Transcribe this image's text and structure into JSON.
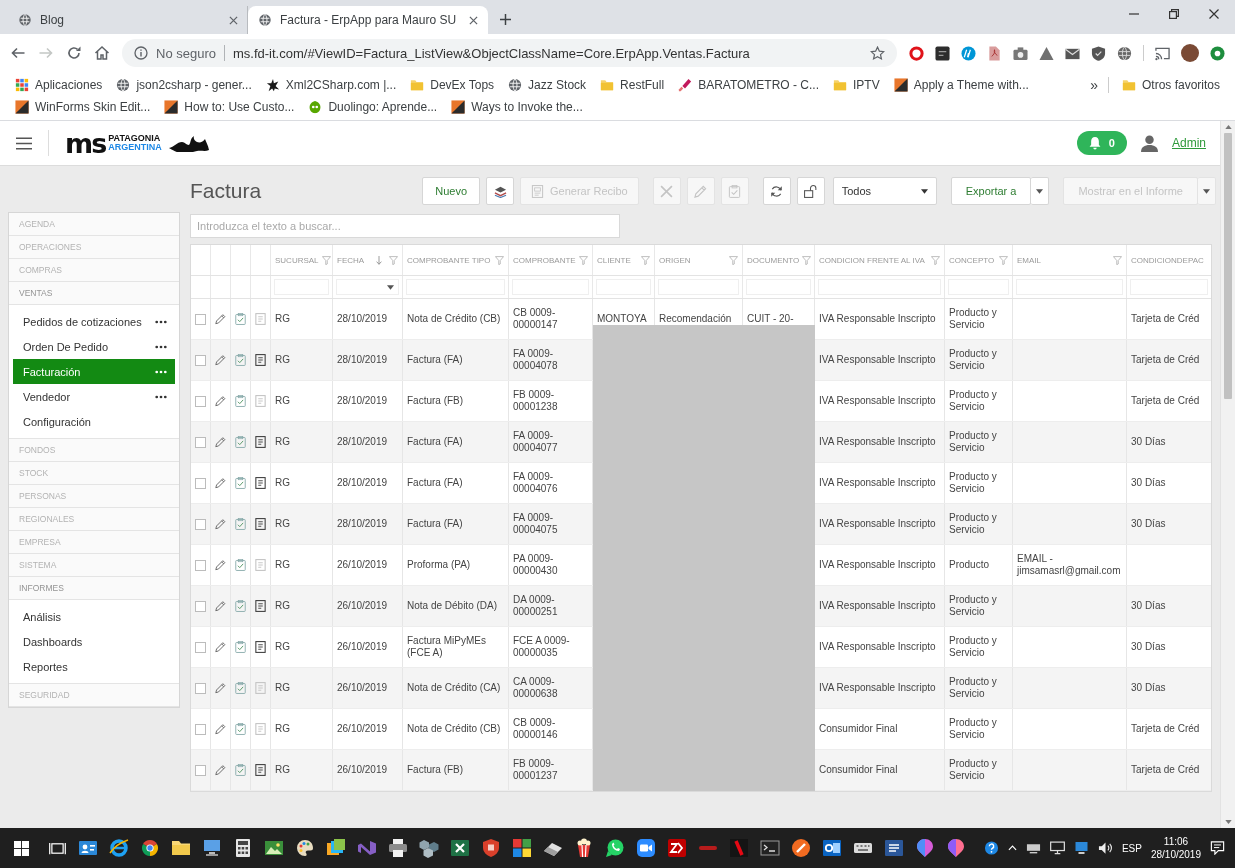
{
  "browser": {
    "tabs": [
      {
        "title": "Blog",
        "selected": false
      },
      {
        "title": "Factura - ErpApp para Mauro SU",
        "selected": true
      }
    ],
    "nav": [
      {
        "kind": "back",
        "disabled": false
      },
      {
        "kind": "forward",
        "disabled": true
      },
      {
        "kind": "reload",
        "disabled": false
      },
      {
        "kind": "home",
        "disabled": false
      }
    ],
    "address": {
      "security": "No seguro",
      "url": "ms.fd-it.com/#ViewID=Factura_ListView&ObjectClassName=Core.ErpApp.Ventas.Factura"
    },
    "bookmarks": [
      {
        "kind": "apps",
        "label": "Aplicaciones"
      },
      {
        "kind": "globe",
        "label": "json2csharp - gener..."
      },
      {
        "kind": "splat",
        "label": "Xml2CSharp.com |..."
      },
      {
        "kind": "folder",
        "label": "DevEx Tops"
      },
      {
        "kind": "globe",
        "label": "Jazz Stock"
      },
      {
        "kind": "folder",
        "label": "RestFull"
      },
      {
        "kind": "brush",
        "label": "BARATOMETRO - C..."
      },
      {
        "kind": "folder",
        "label": "IPTV"
      },
      {
        "kind": "tile",
        "label": "Apply a Theme with..."
      },
      {
        "kind": "tile",
        "label": "WinForms Skin Edit..."
      },
      {
        "kind": "tile",
        "label": "How to: Use Custo..."
      },
      {
        "kind": "leaf",
        "label": "Duolingo: Aprende..."
      },
      {
        "kind": "tile",
        "label": "Ways to Invoke the..."
      }
    ],
    "more_bookmarks": "»",
    "other_bookmarks": "Otros favoritos"
  },
  "app": {
    "logo": {
      "mark": "ms",
      "line1": "PATAGONIA",
      "line2": "ARGENTINA"
    },
    "notifications": {
      "count": "0"
    },
    "user": {
      "name": "Admin"
    },
    "sidebar": {
      "groups": [
        {
          "label": "AGENDA",
          "expanded": false
        },
        {
          "label": "OPERACIONES",
          "expanded": false
        },
        {
          "label": "COMPRAS",
          "expanded": false
        },
        {
          "label": "VENTAS",
          "expanded": true,
          "items": [
            {
              "label": "Pedidos de cotizaciones",
              "has_menu": true,
              "selected": false
            },
            {
              "label": "Orden De Pedido",
              "has_menu": true,
              "selected": false
            },
            {
              "label": "Facturación",
              "has_menu": true,
              "selected": true
            },
            {
              "label": "Vendedor",
              "has_menu": true,
              "selected": false
            },
            {
              "label": "Configuración",
              "has_menu": false,
              "selected": false
            }
          ]
        },
        {
          "label": "FONDOS",
          "expanded": false
        },
        {
          "label": "STOCK",
          "expanded": false
        },
        {
          "label": "PERSONAS",
          "expanded": false
        },
        {
          "label": "REGIONALES",
          "expanded": false
        },
        {
          "label": "EMPRESA",
          "expanded": false
        },
        {
          "label": "SISTEMA",
          "expanded": false
        },
        {
          "label": "INFORMES",
          "expanded": true,
          "items": [
            {
              "label": "Análisis",
              "has_menu": false,
              "selected": false
            },
            {
              "label": "Dashboards",
              "has_menu": false,
              "selected": false
            },
            {
              "label": "Reportes",
              "has_menu": false,
              "selected": false
            }
          ]
        },
        {
          "label": "SEGURIDAD",
          "expanded": false
        }
      ]
    },
    "title": "Factura",
    "toolbar": [
      {
        "kind": "new",
        "label": "Nuevo",
        "disabled": false
      },
      {
        "kind": "tool",
        "disabled": false
      },
      {
        "kind": "receipt",
        "label": "Generar Recibo",
        "disabled": true
      },
      {
        "kind": "delete",
        "disabled": true
      },
      {
        "kind": "edit",
        "disabled": true
      },
      {
        "kind": "approve",
        "disabled": true
      },
      {
        "kind": "refresh",
        "disabled": false
      },
      {
        "kind": "unlock",
        "disabled": false
      },
      {
        "kind": "select",
        "value": "Todos",
        "disabled": false
      },
      {
        "kind": "split",
        "label": "Exportar a",
        "disabled": false
      },
      {
        "kind": "split",
        "label": "Mostrar en el Informe",
        "disabled": true
      }
    ],
    "search": {
      "placeholder": "Introduzca el texto a buscar..."
    },
    "table": {
      "columns": [
        {
          "kind": "text",
          "label": "SUCURSAL",
          "sort_desc": false,
          "filter": true
        },
        {
          "kind": "date",
          "label": "FECHA",
          "sort_desc": true,
          "filter": true
        },
        {
          "kind": "text",
          "label": "COMPROBANTE TIPO",
          "sort_desc": false,
          "filter": true
        },
        {
          "kind": "text",
          "label": "COMPROBANTE",
          "sort_desc": false,
          "filter": true
        },
        {
          "kind": "text",
          "label": "CLIENTE",
          "sort_desc": false,
          "filter": true
        },
        {
          "kind": "text",
          "label": "ORIGEN",
          "sort_desc": false,
          "filter": true
        },
        {
          "kind": "text",
          "label": "DOCUMENTO",
          "sort_desc": false,
          "filter": true
        },
        {
          "kind": "text",
          "label": "CONDICION FRENTE AL IVA",
          "sort_desc": false,
          "filter": true
        },
        {
          "kind": "text",
          "label": "CONCEPTO",
          "sort_desc": false,
          "filter": true
        },
        {
          "kind": "text",
          "label": "EMAIL",
          "sort_desc": false,
          "filter": true
        },
        {
          "kind": "text",
          "label": "CONDICIONDEPAC",
          "sort_desc": false,
          "filter": false
        }
      ],
      "rows": [
        {
          "selected": false,
          "doc_enabled": false,
          "cells": [
            "RG",
            "28/10/2019",
            "Nota de Crédito (CB)",
            "CB 0009-00000147",
            "MONTOYA",
            "Recomendación",
            "CUIT - 20-",
            "IVA Responsable Inscripto",
            "Producto y Servicio",
            null,
            "Tarjeta de Créd"
          ]
        },
        {
          "selected": false,
          "doc_enabled": true,
          "cells": [
            "RG",
            "28/10/2019",
            "Factura (FA)",
            "FA 0009-00004078",
            null,
            null,
            null,
            "IVA Responsable Inscripto",
            "Producto y Servicio",
            null,
            "Tarjeta de Créd"
          ]
        },
        {
          "selected": false,
          "doc_enabled": false,
          "cells": [
            "RG",
            "28/10/2019",
            "Factura (FB)",
            "FB 0009-00001238",
            null,
            null,
            null,
            "IVA Responsable Inscripto",
            "Producto y Servicio",
            null,
            "Tarjeta de Créd"
          ]
        },
        {
          "selected": false,
          "doc_enabled": true,
          "cells": [
            "RG",
            "28/10/2019",
            "Factura (FA)",
            "FA 0009-00004077",
            null,
            null,
            null,
            "IVA Responsable Inscripto",
            "Producto y Servicio",
            null,
            "30 Días"
          ]
        },
        {
          "selected": false,
          "doc_enabled": true,
          "cells": [
            "RG",
            "28/10/2019",
            "Factura (FA)",
            "FA 0009-00004076",
            null,
            null,
            null,
            "IVA Responsable Inscripto",
            "Producto y Servicio",
            null,
            "30 Días"
          ]
        },
        {
          "selected": false,
          "doc_enabled": true,
          "cells": [
            "RG",
            "28/10/2019",
            "Factura (FA)",
            "FA 0009-00004075",
            null,
            null,
            null,
            "IVA Responsable Inscripto",
            "Producto y Servicio",
            null,
            "30 Días"
          ]
        },
        {
          "selected": false,
          "doc_enabled": false,
          "cells": [
            "RG",
            "26/10/2019",
            "Proforma (PA)",
            "PA 0009-00000430",
            null,
            null,
            null,
            "IVA Responsable Inscripto",
            "Producto",
            "EMAIL - jimsamasrl@gmail.com",
            null
          ]
        },
        {
          "selected": false,
          "doc_enabled": true,
          "cells": [
            "RG",
            "26/10/2019",
            "Nota de Débito (DA)",
            "DA 0009-00000251",
            null,
            null,
            null,
            "IVA Responsable Inscripto",
            "Producto y Servicio",
            null,
            "30 Días"
          ]
        },
        {
          "selected": false,
          "doc_enabled": true,
          "cells": [
            "RG",
            "26/10/2019",
            "Factura MiPyMEs (FCE A)",
            "FCE A 0009-00000035",
            null,
            null,
            null,
            "IVA Responsable Inscripto",
            "Producto y Servicio",
            null,
            "30 Días"
          ]
        },
        {
          "selected": false,
          "doc_enabled": false,
          "cells": [
            "RG",
            "26/10/2019",
            "Nota de Crédito (CA)",
            "CA 0009-00000638",
            null,
            null,
            null,
            "IVA Responsable Inscripto",
            "Producto y Servicio",
            null,
            "30 Días"
          ]
        },
        {
          "selected": false,
          "doc_enabled": false,
          "cells": [
            "RG",
            "26/10/2019",
            "Nota de Crédito (CB)",
            "CB 0009-00000146",
            null,
            null,
            null,
            "Consumidor Final",
            "Producto y Servicio",
            null,
            "Tarjeta de Créd"
          ]
        },
        {
          "selected": false,
          "doc_enabled": true,
          "cells": [
            "RG",
            "26/10/2019",
            "Factura (FB)",
            "FB 0009-00001237",
            null,
            null,
            null,
            "Consumidor Final",
            "Producto y Servicio",
            null,
            "Tarjeta de Créd"
          ]
        }
      ]
    }
  },
  "taskbar": {
    "language": "ESP",
    "time": "11:06",
    "date": "28/10/2019"
  }
}
